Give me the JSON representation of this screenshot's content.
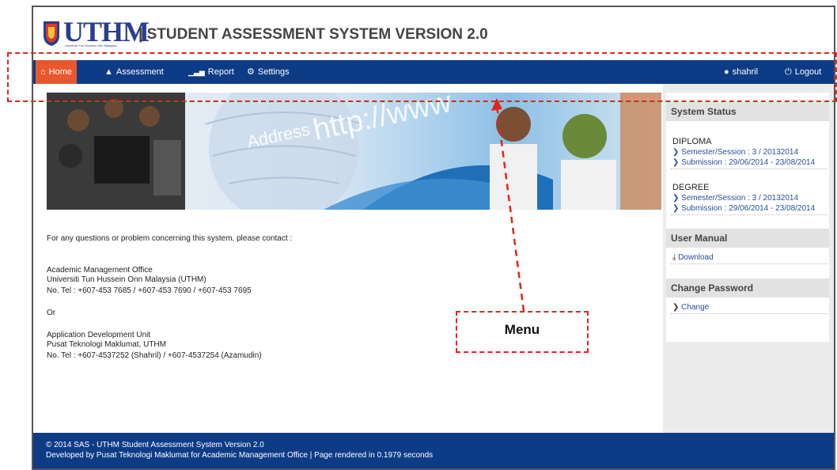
{
  "header": {
    "logo_text": "UTHM",
    "logo_subtitle": "Universiti Tun Hussein Onn Malaysia",
    "title": "| STUDENT ASSESSMENT SYSTEM VERSION 2.0"
  },
  "nav": {
    "items": [
      {
        "label": "Home",
        "icon": "home-icon",
        "active": true
      },
      {
        "label": "Assessment",
        "icon": "fire-icon"
      },
      {
        "label": "Report",
        "icon": "signal-icon"
      },
      {
        "label": "Settings",
        "icon": "gear-icon"
      }
    ],
    "user": {
      "label": "shahril",
      "icon": "user-icon"
    },
    "logout": {
      "label": "Logout",
      "icon": "power-icon"
    }
  },
  "banner": {
    "text_address": "Address",
    "text_url": "http://www"
  },
  "content": {
    "intro": "For any questions or problem concerning this system, please contact :",
    "office1": {
      "name": "Academic Management Office",
      "org": "Universiti Tun Hussein Onn Malaysia (UTHM)",
      "tel": "No. Tel : +607-453 7685 / +607-453 7690 / +607-453 7695"
    },
    "or": "Or",
    "office2": {
      "name": "Application Development Unit",
      "org": "Pusat Teknologi Maklumat, UTHM",
      "tel": "No. Tel : +607-4537252 (Shahril) / +607-4537254 (Azamudin)"
    }
  },
  "sidebar": {
    "status_title": "System Status",
    "diploma": {
      "label": "DIPLOMA",
      "semester": "Semester/Session : 3 / 20132014",
      "submission": "Submission : 29/06/2014 - 23/08/2014"
    },
    "degree": {
      "label": "DEGREE",
      "semester": "Semester/Session : 3 / 20132014",
      "submission": "Submission : 29/06/2014 - 23/08/2014"
    },
    "manual_title": "User Manual",
    "download": "Download",
    "password_title": "Change Password",
    "change": "Change"
  },
  "footer": {
    "line1": "© 2014 SAS - UTHM Student Assessment System Version 2.0",
    "line2": "Developed by Pusat Teknologi Maklumat for Academic Management Office | Page rendered in 0.1979 seconds"
  },
  "annotation": {
    "label": "Menu",
    "color": "#e0261c"
  }
}
